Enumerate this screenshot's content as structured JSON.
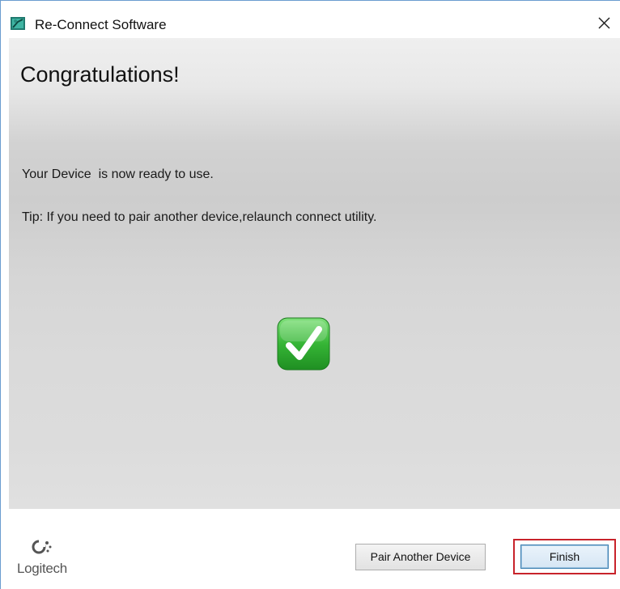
{
  "window": {
    "title": "Re-Connect Software",
    "close_glyph": "✕",
    "app_icon": "reconnect-app-icon"
  },
  "content": {
    "heading": "Congratulations!",
    "message": "Your Device  is now ready to use.",
    "tip": "Tip: If you need to pair another device,relaunch connect utility.",
    "status_icon": "green-checkmark-icon"
  },
  "footer": {
    "logo_text": "Logitech",
    "logo_icon": "logitech-logo-icon",
    "pair_another_label": "Pair Another Device",
    "finish_label": "Finish"
  },
  "colors": {
    "check_green": "#3cb43c",
    "focus_outline": "#c8232b",
    "window_border": "#6a9ccf"
  }
}
